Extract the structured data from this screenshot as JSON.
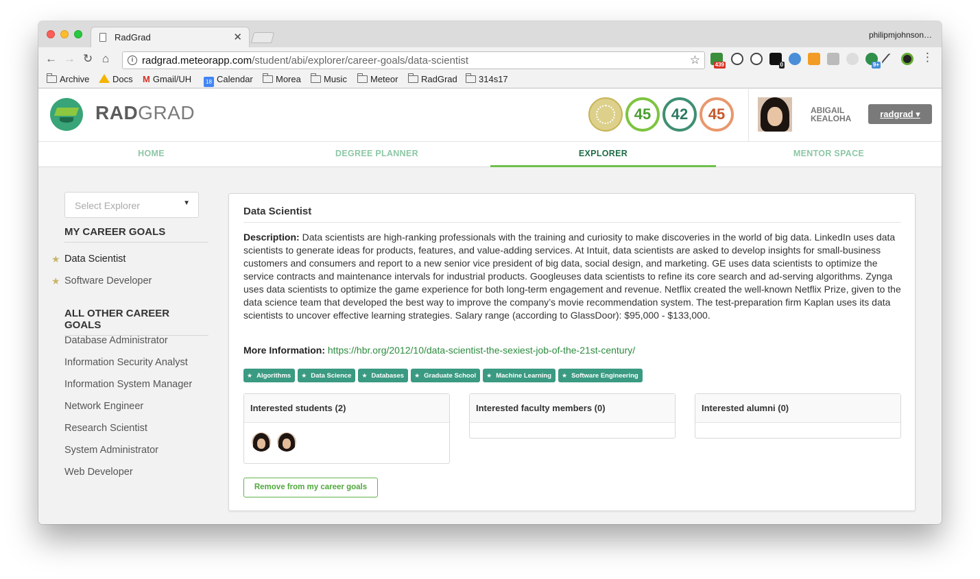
{
  "browser": {
    "tab_title": "RadGrad",
    "profile_name": "philipmjohnson…",
    "url_host": "radgrad.meteorapp.com",
    "url_path": "/student/abi/explorer/career-goals/data-scientist",
    "extension_badges": {
      "mail_count": "439",
      "jb_count": "0",
      "ext_plus": "9+"
    },
    "bookmarks": [
      "Archive",
      "Docs",
      "Gmail/UH",
      "Calendar",
      "Morea",
      "Music",
      "Meteor",
      "RadGrad",
      "314s17"
    ],
    "calendar_day": "18"
  },
  "app": {
    "logo_rad": "RAD",
    "logo_grad": "GRAD",
    "scores": {
      "innovation": "45",
      "competency": "42",
      "experience": "45"
    },
    "user": {
      "first": "ABIGAIL",
      "last": "KEALOHA",
      "button": "radgrad ▾"
    },
    "nav": [
      "HOME",
      "DEGREE PLANNER",
      "EXPLORER",
      "MENTOR SPACE"
    ]
  },
  "sidebar": {
    "select_placeholder": "Select Explorer",
    "my_heading": "MY CAREER GOALS",
    "my_goals": [
      "Data Scientist",
      "Software Developer"
    ],
    "other_heading": "ALL OTHER CAREER GOALS",
    "other_goals": [
      "Database Administrator",
      "Information Security Analyst",
      "Information System Manager",
      "Network Engineer",
      "Research Scientist",
      "System Administrator",
      "Web Developer"
    ]
  },
  "card": {
    "title": "Data Scientist",
    "desc_label": "Description:",
    "desc_text": "Data scientists are high-ranking professionals with the training and curiosity to make discoveries in the world of big data. LinkedIn uses data scientists to generate ideas for products, features, and value-adding services. At Intuit, data scientists are asked to develop insights for small-business customers and consumers and report to a new senior vice president of big data, social design, and marketing. GE uses data scientists to optimize the service contracts and maintenance intervals for industrial products. Googleuses data scientists to refine its core search and ad-serving algorithms. Zynga uses data scientists to optimize the game experience for both long-term engagement and revenue. Netflix created the well-known Netflix Prize, given to the data science team that developed the best way to improve the company’s movie recommendation system. The test-preparation firm Kaplan uses its data scientists to uncover effective learning strategies. Salary range (according to GlassDoor): $95,000 - $133,000.",
    "more_label": "More Information:",
    "more_link": "https://hbr.org/2012/10/data-scientist-the-sexiest-job-of-the-21st-century/",
    "tags": [
      "Algorithms",
      "Data Science",
      "Databases",
      "Graduate School",
      "Machine Learning",
      "Software Engineering"
    ],
    "interested_students": "Interested students (2)",
    "interested_faculty": "Interested faculty members (0)",
    "interested_alumni": "Interested alumni (0)",
    "remove_button": "Remove from my career goals"
  }
}
